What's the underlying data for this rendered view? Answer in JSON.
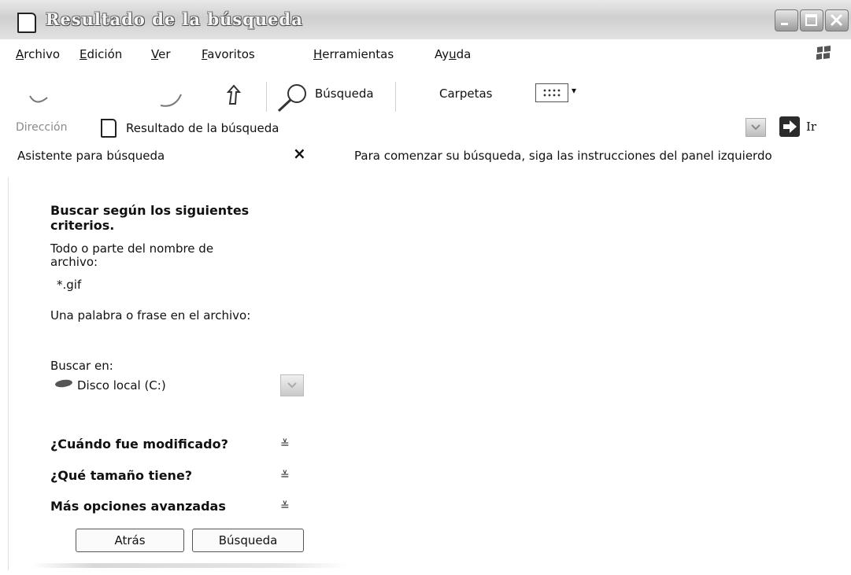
{
  "window": {
    "title": "Resultado de la búsqueda"
  },
  "menu": {
    "items": [
      {
        "label": "Archivo",
        "underline": "A"
      },
      {
        "label": "Edición",
        "underline": "E"
      },
      {
        "label": "Ver",
        "underline": "V"
      },
      {
        "label": "Favoritos",
        "underline": "F"
      },
      {
        "label": "Herramientas",
        "underline": "H"
      },
      {
        "label": "Ayuda",
        "underline": "u"
      }
    ]
  },
  "toolbar": {
    "search_label": "Búsqueda",
    "folders_label": "Carpetas"
  },
  "address": {
    "label": "Dirección",
    "value": "Resultado de la búsqueda",
    "go_label": "Ir"
  },
  "search_pane": {
    "title": "Asistente para búsqueda",
    "close": "×",
    "heading": "Buscar según los siguientes criterios.",
    "filename_label": "Todo o parte del nombre de archivo:",
    "filename_value": "*.gif",
    "phrase_label": "Una palabra o frase en el archivo:",
    "look_in_label": "Buscar en:",
    "look_in_value": "Disco local (C:)",
    "sections": [
      {
        "label": "¿Cuándo fue modificado?",
        "chevron": "≚"
      },
      {
        "label": "¿Qué tamaño tiene?",
        "chevron": "≚"
      },
      {
        "label": "Más opciones avanzadas",
        "chevron": "≚"
      }
    ],
    "back_button": "Atrás",
    "search_button": "Búsqueda"
  },
  "results": {
    "message": "Para comenzar su búsqueda, siga las instrucciones del panel izquierdo"
  }
}
